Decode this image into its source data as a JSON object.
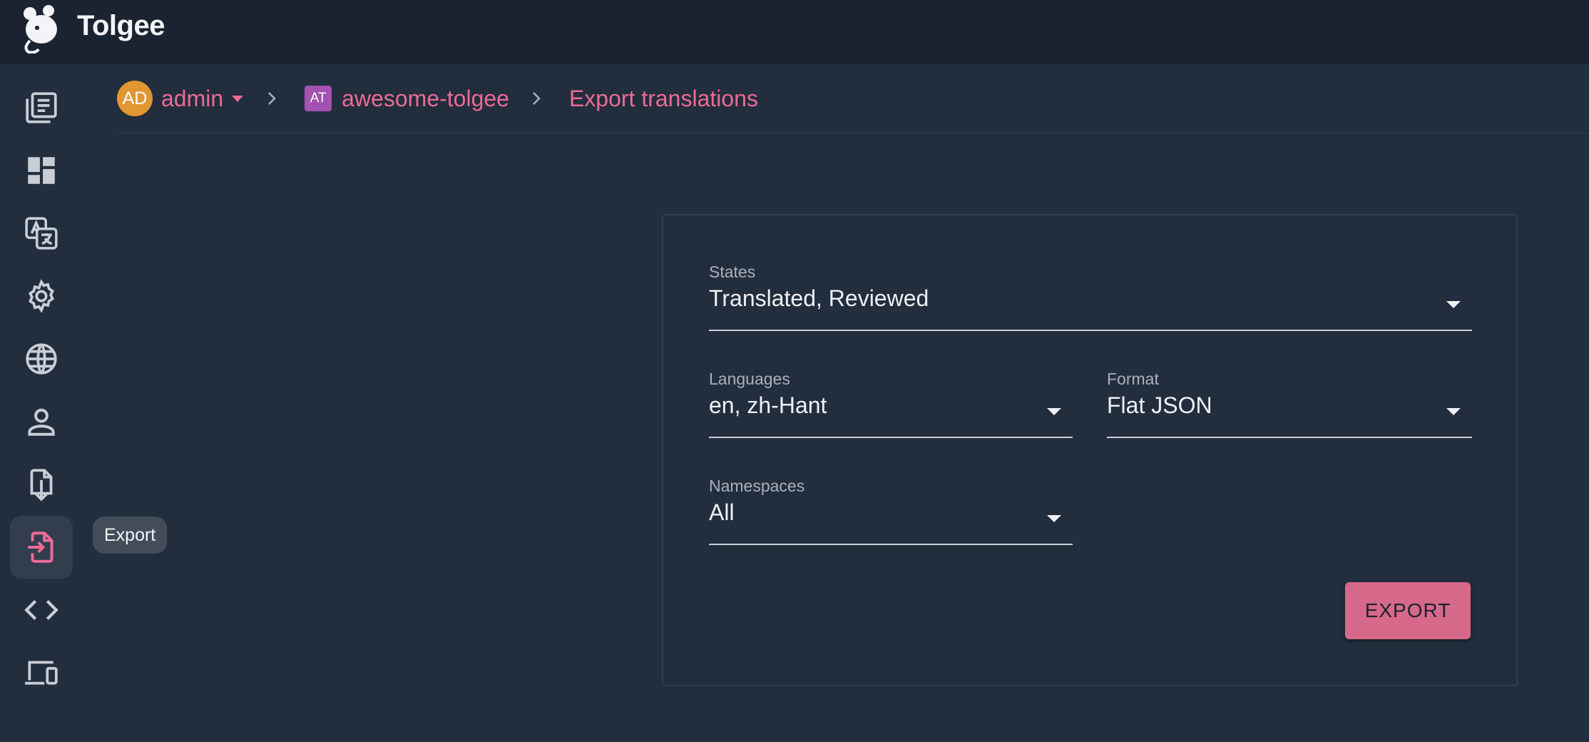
{
  "app": {
    "name": "Tolgee"
  },
  "tooltip": {
    "label": "Export"
  },
  "breadcrumb": {
    "user_initials": "AD",
    "user": "admin",
    "project_initials": "AT",
    "project": "awesome-tolgee",
    "page": "Export translations"
  },
  "sidebar": {
    "items": [
      {
        "name": "projects",
        "icon": "projects-list-icon"
      },
      {
        "name": "dashboard",
        "icon": "dashboard-icon"
      },
      {
        "name": "translations",
        "icon": "translate-icon"
      },
      {
        "name": "settings",
        "icon": "gear-icon"
      },
      {
        "name": "languages",
        "icon": "globe-icon"
      },
      {
        "name": "members",
        "icon": "person-icon"
      },
      {
        "name": "import",
        "icon": "import-file-icon"
      },
      {
        "name": "export",
        "icon": "export-file-icon",
        "active": true
      },
      {
        "name": "developer",
        "icon": "code-icon"
      },
      {
        "name": "integrate",
        "icon": "devices-icon"
      }
    ]
  },
  "form": {
    "states": {
      "label": "States",
      "value": "Translated, Reviewed"
    },
    "languages": {
      "label": "Languages",
      "value": "en, zh-Hant"
    },
    "format": {
      "label": "Format",
      "value": "Flat JSON"
    },
    "namespaces": {
      "label": "Namespaces",
      "value": "All"
    },
    "submit_label": "EXPORT"
  },
  "colors": {
    "accent": "#ec6b96",
    "button": "#d6698a",
    "topbar": "#1b2230",
    "background": "#222d3d",
    "user_avatar": "#e19631",
    "project_avatar": "#a352b1"
  }
}
